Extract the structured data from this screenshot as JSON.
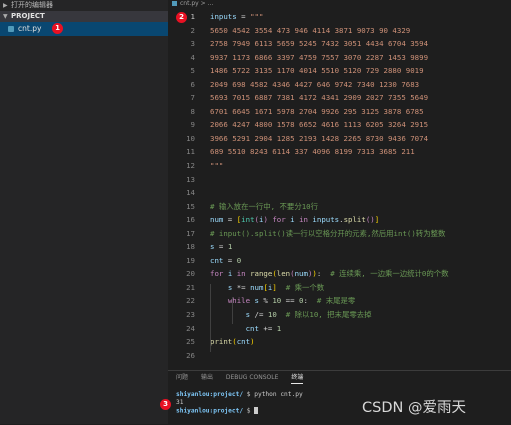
{
  "sidebar": {
    "open_editors_label": "打开的编辑器",
    "project_label": "PROJECT",
    "file_name": "cnt.py",
    "annotation": "1"
  },
  "editor": {
    "breadcrumb_file": "cnt.py",
    "breadcrumb_more": "...",
    "annotation": "2"
  },
  "code_lines": [
    {
      "no": "1",
      "html": "<span class='v'>inputs</span> = <span class='s'>\"\"\"</span>"
    },
    {
      "no": "2",
      "html": "<span class='s'>5650 4542 3554 473 946 4114 3871 9073 90 4329</span>"
    },
    {
      "no": "3",
      "html": "<span class='s'>2758 7949 6113 5659 5245 7432 3051 4434 6704 3594</span>"
    },
    {
      "no": "4",
      "html": "<span class='s'>9937 1173 6866 3397 4759 7557 3070 2287 1453 9899</span>"
    },
    {
      "no": "5",
      "html": "<span class='s'>1486 5722 3135 1170 4014 5510 5120 729 2880 9019</span>"
    },
    {
      "no": "6",
      "html": "<span class='s'>2049 698 4582 4346 4427 646 9742 7340 1230 7683</span>"
    },
    {
      "no": "7",
      "html": "<span class='s'>5693 7015 6887 7381 4172 4341 2909 2027 7355 5649</span>"
    },
    {
      "no": "8",
      "html": "<span class='s'>6701 6645 1671 5978 2704 9926 295 3125 3878 6785</span>"
    },
    {
      "no": "9",
      "html": "<span class='s'>2066 4247 4800 1578 6652 4616 1113 6205 3264 2915</span>"
    },
    {
      "no": "10",
      "html": "<span class='s'>3966 5291 2904 1285 2193 1428 2265 8730 9436 7074</span>"
    },
    {
      "no": "11",
      "html": "<span class='s'>689 5510 8243 6114 337 4096 8199 7313 3685 211</span>"
    },
    {
      "no": "12",
      "html": "<span class='s'>\"\"\"</span>"
    },
    {
      "no": "13",
      "html": ""
    },
    {
      "no": "14",
      "html": ""
    },
    {
      "no": "15",
      "html": "<span class='c'># 输入放在一行中, 不要分10行</span>"
    },
    {
      "no": "16",
      "html": "<span class='v'>num</span> = <span class='b'>[</span><span class='t'>int</span><span class='k'>(</span><span class='v'>i</span><span class='k'>)</span> <span class='k'>for</span> <span class='v'>i</span> <span class='k'>in</span> <span class='v'>inputs</span>.<span class='f'>split</span><span class='k'>()</span><span class='b'>]</span>"
    },
    {
      "no": "17",
      "html": "<span class='c'># input().split()读一行以空格分开的元素,然后用int()转为整数</span>"
    },
    {
      "no": "18",
      "html": "<span class='v'>s</span> = <span class='n'>1</span>"
    },
    {
      "no": "19",
      "html": "<span class='v'>cnt</span> = <span class='n'>0</span>"
    },
    {
      "no": "20",
      "html": "<span class='k'>for</span> <span class='v'>i</span> <span class='k'>in</span> <span class='f'>range</span><span class='b'>(</span><span class='f'>len</span><span class='k'>(</span><span class='v'>num</span><span class='k'>)</span><span class='b'>)</span>:  <span class='c'># 连续乘, 一边乘一边统计0的个数</span>"
    },
    {
      "no": "21",
      "html": "    <span class='v'>s</span> *= <span class='v'>num</span><span class='b'>[</span><span class='v'>i</span><span class='b'>]</span>  <span class='c'># 乘一个数</span>"
    },
    {
      "no": "22",
      "html": "    <span class='k'>while</span> <span class='v'>s</span> % <span class='n'>10</span> == <span class='n'>0</span>:  <span class='c'># 末尾是零</span>"
    },
    {
      "no": "23",
      "html": "        <span class='v'>s</span> /= <span class='n'>10</span>  <span class='c'># 除以10, 把末尾零去掉</span>"
    },
    {
      "no": "24",
      "html": "        <span class='v'>cnt</span> += <span class='n'>1</span>"
    },
    {
      "no": "25",
      "html": "<span class='f'>print</span><span class='b'>(</span><span class='v'>cnt</span><span class='b'>)</span>"
    },
    {
      "no": "26",
      "html": ""
    }
  ],
  "panel": {
    "tabs": [
      "问题",
      "输出",
      "DEBUG CONSOLE",
      "终端"
    ],
    "active_tab": "终端",
    "annotation": "3",
    "terminal": {
      "line1_user": "shiyanlou:project/",
      "line1_cmd": "$ python cnt.py",
      "line2_output": "31",
      "line3_user": "shiyanlou:project/",
      "line3_prompt": "$"
    }
  },
  "watermark": "CSDN @爱雨天",
  "colors": {
    "string": "#ce9178",
    "comment": "#6a9955",
    "keyword": "#c586c0",
    "variable": "#9cdcfe",
    "function": "#dcdcaa",
    "type": "#4ec9b0",
    "number": "#b5cea8",
    "badge": "#e81123"
  }
}
